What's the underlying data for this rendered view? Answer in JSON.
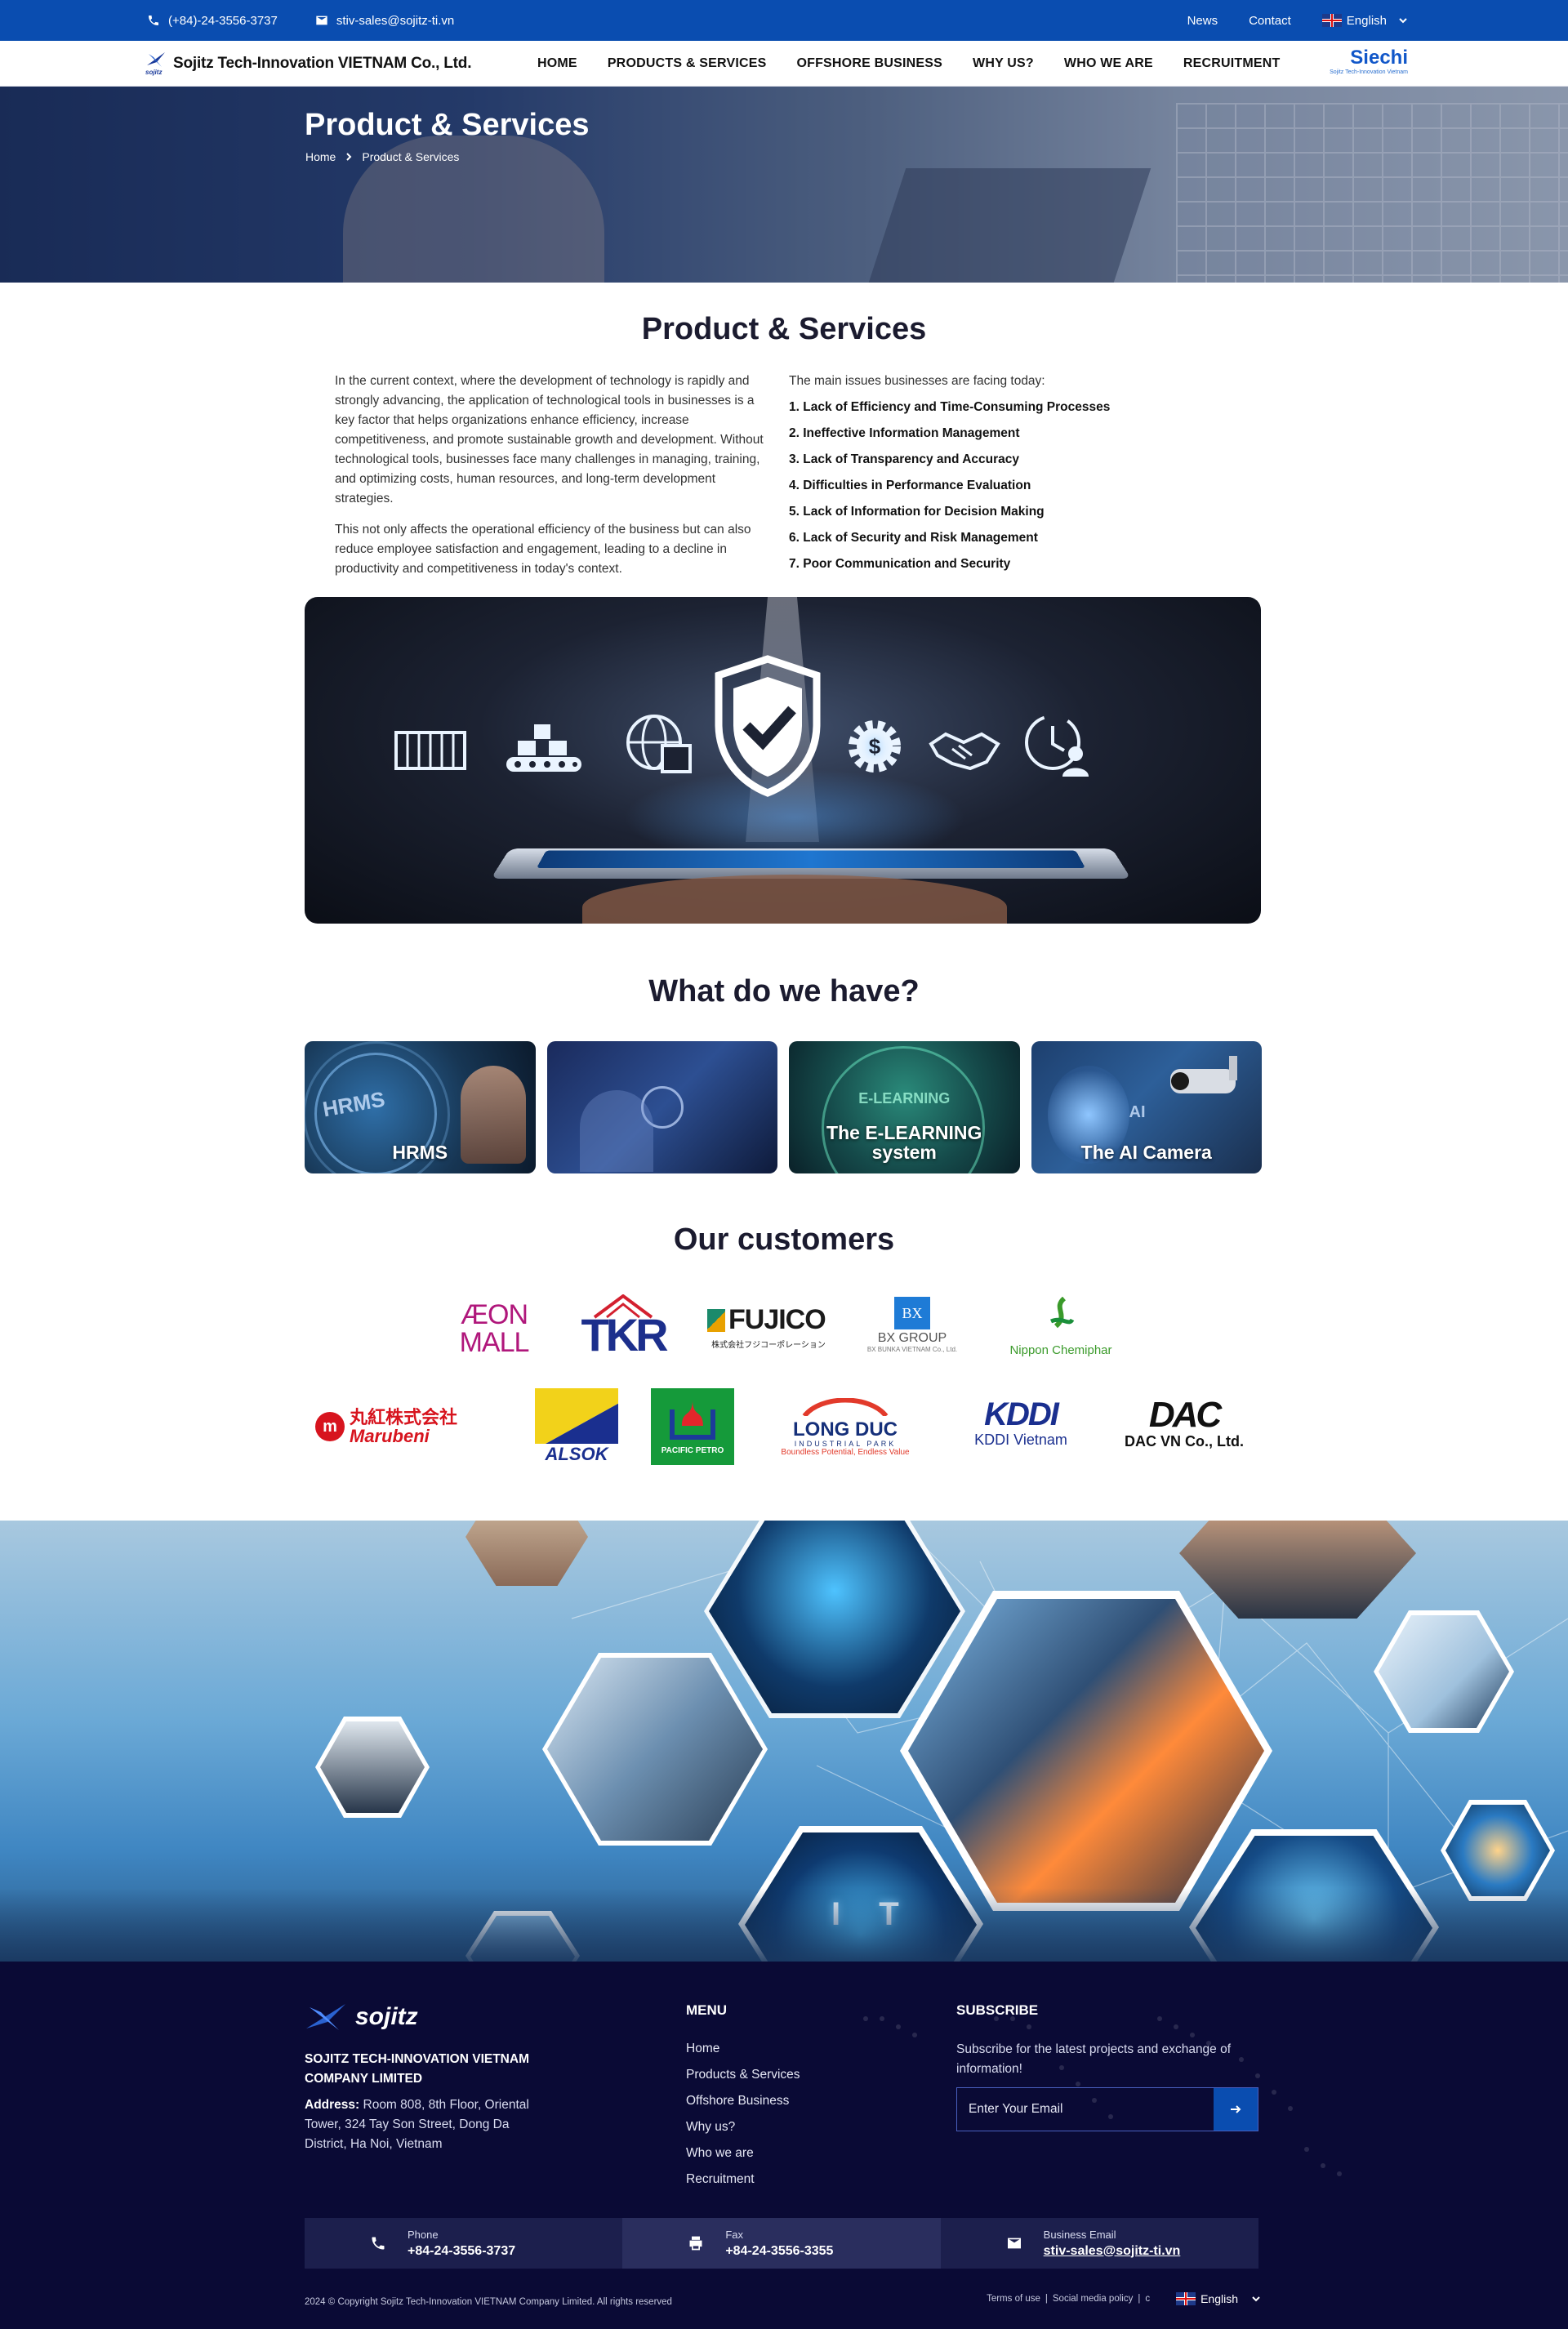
{
  "topbar": {
    "phone": "(+84)-24-3556-3737",
    "email": "stiv-sales@sojitz-ti.vn",
    "links": [
      "News",
      "Contact"
    ],
    "language": "English"
  },
  "nav": {
    "brand": "Sojitz Tech-Innovation VIETNAM Co., Ltd.",
    "brand_small": "sojitz",
    "items": [
      "HOME",
      "PRODUCTS & SERVICES",
      "OFFSHORE BUSINESS",
      "WHY US?",
      "WHO WE ARE",
      "RECRUITMENT"
    ],
    "partner_logo": "Siechi",
    "partner_sub": "Sojitz Tech-Innovation Vietnam"
  },
  "hero": {
    "title": "Product & Services",
    "breadcrumb": [
      "Home",
      "Product & Services"
    ]
  },
  "intro": {
    "heading": "Product & Services",
    "paragraphs": [
      "In the current context, where the development of technology is rapidly and strongly advancing, the application of technological tools in businesses is a key factor that helps organizations enhance efficiency, increase competitiveness, and promote sustainable growth and development. Without technological tools, businesses face many challenges in managing, training, and optimizing costs, human resources, and long-term development strategies.",
      "This not only affects the operational efficiency of the business but can also reduce employee satisfaction and engagement, leading to a decline in productivity and competitiveness in today's context."
    ],
    "issues_intro": "The main issues businesses are facing today:",
    "issues": [
      "1. Lack of Efficiency and Time-Consuming Processes",
      "2. Ineffective Information Management",
      "3. Lack of Transparency and Accuracy",
      "4. Difficulties in Performance Evaluation",
      "5. Lack of Information for Decision Making",
      "6. Lack of Security and Risk Management",
      "7. Poor Communication and Security"
    ]
  },
  "products": {
    "heading": "What do we have?",
    "cards": [
      {
        "label": "HRMS",
        "inner": "HRMS"
      },
      {
        "label": "",
        "inner": ""
      },
      {
        "label": "The E-LEARNING system",
        "inner": "E-LEARNING"
      },
      {
        "label": "The AI Camera",
        "inner": "AI"
      }
    ]
  },
  "customers": {
    "heading": "Our customers",
    "row1": [
      {
        "name": "AEON MALL",
        "line1": "ÆON",
        "line2": "MALL",
        "color": "#b0177b"
      },
      {
        "name": "TKR",
        "line1": "TKR",
        "line2": "",
        "color": "#1c2f8c"
      },
      {
        "name": "FUJICO",
        "line1": "FUJICO",
        "line2": "株式会社フジコーポレーション",
        "color": "#1b1b1b"
      },
      {
        "name": "BX GROUP",
        "line1": "BX GROUP",
        "line2": "BX BUNKA VIETNAM Co., Ltd.",
        "color": "#1e7bd6"
      },
      {
        "name": "Nippon Chemiphar",
        "line1": "Nippon Chemiphar",
        "line2": "",
        "color": "#3a9a2a"
      }
    ],
    "row2": [
      {
        "name": "Marubeni",
        "line1": "丸紅株式会社",
        "line2": "Marubeni",
        "color": "#d7141e"
      },
      {
        "name": "ALSOK",
        "line1": "ALSOK",
        "line2": "",
        "color": "#1a2f8f"
      },
      {
        "name": "PACIFIC PETRO",
        "line1": "PACIFIC PETRO",
        "line2": "",
        "color": "#159a3a"
      },
      {
        "name": "LONG DUC",
        "line1": "LONG DUC",
        "line2": "INDUSTRIAL PARK",
        "line3": "Boundless Potential, Endless Value",
        "color": "#16307a"
      },
      {
        "name": "KDDI Vietnam",
        "line1": "KDDI",
        "line2": "KDDI Vietnam",
        "color": "#1a2f8f"
      },
      {
        "name": "DAC VN Co., Ltd.",
        "line1": "DAC",
        "line2": "DAC VN Co., Ltd.",
        "color": "#111111"
      }
    ]
  },
  "footer": {
    "logo": "sojitz",
    "company": "SOJITZ TECH-INNOVATION VIETNAM COMPANY LIMITED",
    "address_label": "Address:",
    "address": "Room 808, 8th Floor, Oriental Tower, 324 Tay Son Street, Dong Da District, Ha Noi, Vietnam",
    "menu_heading": "MENU",
    "menu": [
      "Home",
      "Products & Services",
      "Offshore Business",
      "Why us?",
      "Who we are",
      "Recruitment"
    ],
    "subscribe_heading": "SUBSCRIBE",
    "subscribe_text": "Subscribe for the latest projects and exchange of information!",
    "subscribe_placeholder": "Enter Your Email",
    "contacts": [
      {
        "label": "Phone",
        "value": "+84-24-3556-3737",
        "icon": "phone-icon"
      },
      {
        "label": "Fax",
        "value": "+84-24-3556-3355",
        "icon": "printer-icon"
      },
      {
        "label": "Business Email",
        "value": "stiv-sales@sojitz-ti.vn",
        "icon": "mail-icon"
      }
    ],
    "copyright": "2024 © Copyright Sojitz Tech-Innovation VIETNAM Company Limited. All rights reserved",
    "legal": [
      "Terms of use",
      "Social media policy",
      "c"
    ],
    "language": "English"
  }
}
